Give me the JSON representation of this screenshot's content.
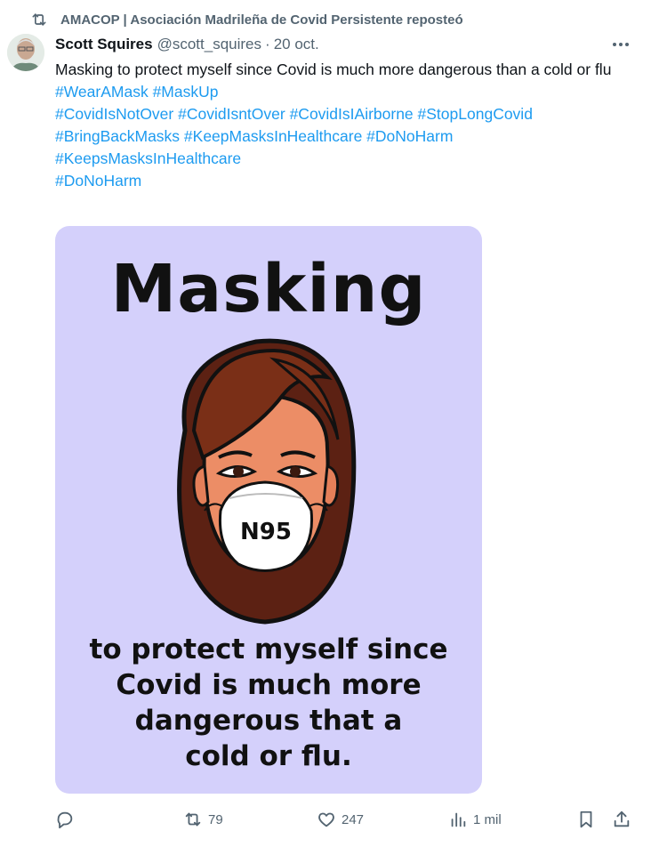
{
  "repost": {
    "text": "AMACOP | Asociación Madrileña de Covid Persistente reposteó"
  },
  "author": {
    "name": "Scott Squires",
    "handle": "@scott_squires",
    "separator": "·",
    "date": "20 oct."
  },
  "tweet": {
    "text": "Masking to protect myself since Covid is much more dangerous than a cold or flu",
    "hashtag_lines": [
      "#WearAMask #MaskUp",
      "#CovidIsNotOver #CovidIsntOver #CovidIsIAirborne #StopLongCovid",
      "#BringBackMasks #KeepMasksInHealthcare #DoNoHarm",
      "#KeepsMasksInHealthcare",
      "#DoNoHarm"
    ]
  },
  "image": {
    "title": "Masking",
    "mask_label": "N95",
    "caption_lines": [
      "to protect myself since",
      "Covid is much more",
      "dangerous that a",
      "cold or flu."
    ],
    "background": "#d4d0fb"
  },
  "actions": {
    "replies": "",
    "reposts": "79",
    "likes": "247",
    "views": "1 mil"
  },
  "colors": {
    "link": "#1d9bf0",
    "muted": "#536471",
    "text": "#0f1419"
  },
  "icons": [
    "repost-icon",
    "more-icon",
    "reply-icon",
    "like-icon",
    "views-icon",
    "bookmark-icon",
    "share-icon"
  ]
}
